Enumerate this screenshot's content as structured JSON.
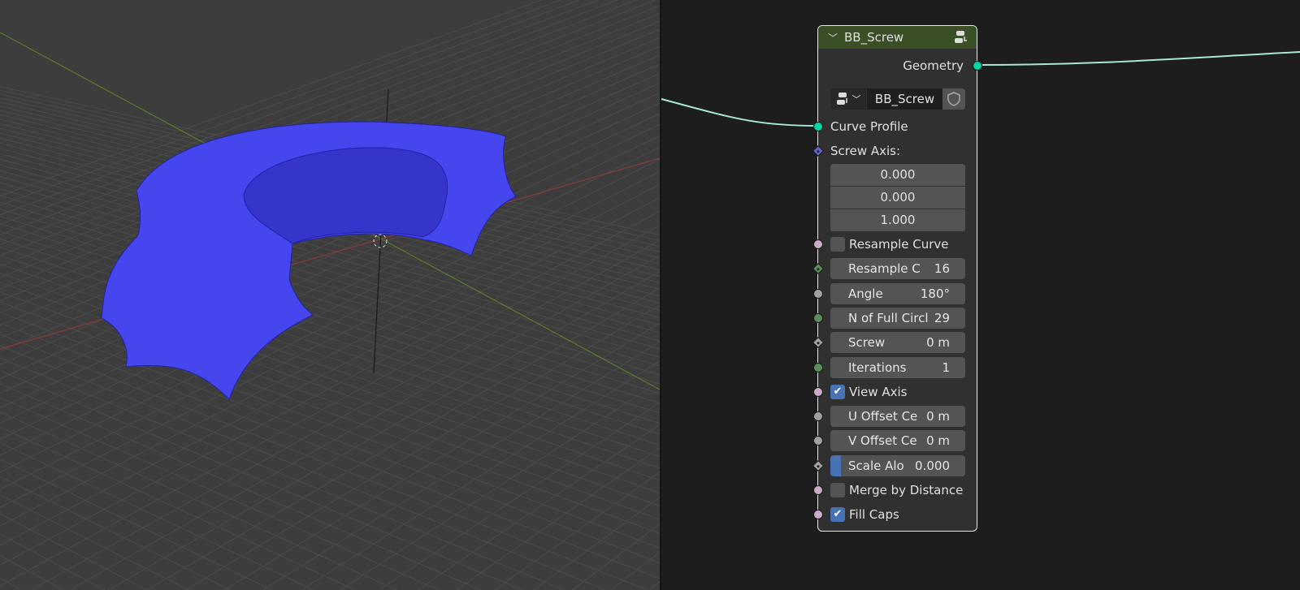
{
  "node": {
    "title": "BB_Screw",
    "output": "Geometry",
    "datablock": "BB_Screw",
    "inputs": {
      "curve_profile": "Curve Profile",
      "screw_axis": "Screw Axis:",
      "screw_axis_values": [
        "0.000",
        "0.000",
        "1.000"
      ],
      "resample_curve": {
        "label": "Resample Curve",
        "checked": false
      },
      "resample_count": {
        "label": "Resample C",
        "value": "16"
      },
      "angle": {
        "label": "Angle",
        "value": "180°"
      },
      "full_circle": {
        "label": "N of Full Circl",
        "value": "29"
      },
      "screw": {
        "label": "Screw",
        "value": "0 m"
      },
      "iterations": {
        "label": "Iterations",
        "value": "1"
      },
      "view_axis": {
        "label": "View Axis",
        "checked": true
      },
      "u_offset": {
        "label": "U Offset Ce",
        "value": "0 m"
      },
      "v_offset": {
        "label": "V Offset Ce",
        "value": "0 m"
      },
      "scale_along": {
        "label": "Scale Alo",
        "value": "0.000"
      },
      "merge_by_distance": {
        "label": "Merge by Distance",
        "checked": false
      },
      "fill_caps": {
        "label": "Fill Caps",
        "checked": true
      }
    }
  },
  "colors": {
    "header": "#3b4f27",
    "geometry_socket": "#00d6a3",
    "bool_socket": "#ccaacc",
    "int_socket": "#5a8f5a",
    "float_socket": "#a1a1a1",
    "vector_socket": "#6363c7",
    "mesh": "#4646ee"
  }
}
